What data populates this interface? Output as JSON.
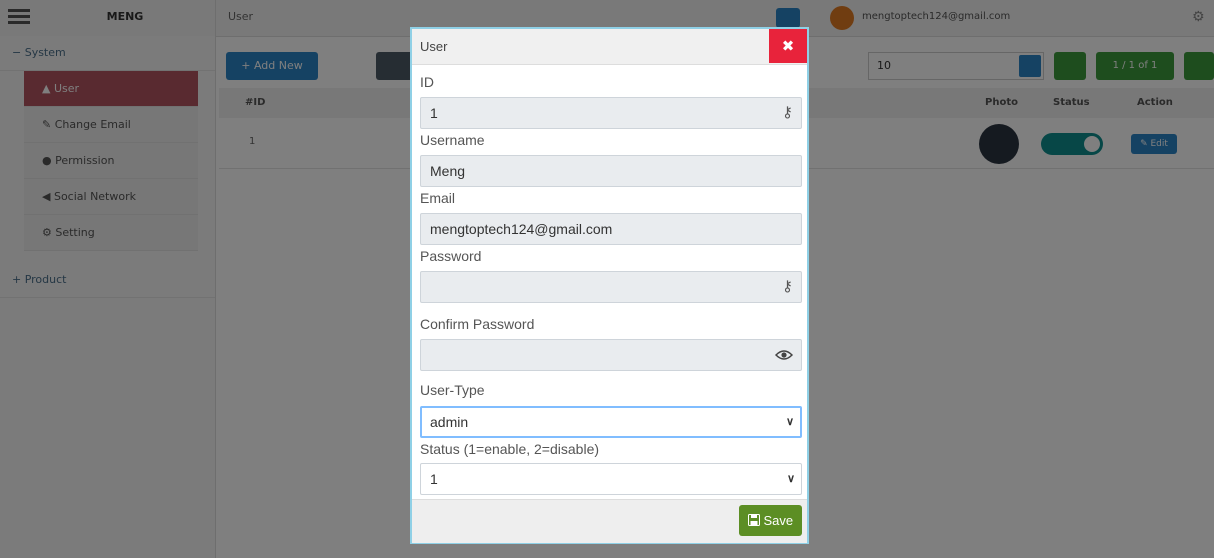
{
  "app": {
    "brand": "MENG",
    "breadcrumb": "User",
    "user_email": "mengtoptech124@gmail.com"
  },
  "sidebar": {
    "groups": [
      {
        "label": "− System"
      },
      {
        "label": "+ Product"
      }
    ],
    "items": [
      {
        "label": "▲ User"
      },
      {
        "label": "✎ Change Email"
      },
      {
        "label": "● Permission"
      },
      {
        "label": "◀ Social Network"
      },
      {
        "label": "⚙ Setting"
      }
    ]
  },
  "toolbar": {
    "add_new_label": "+ Add New",
    "page_size_value": "10",
    "pager_label": "1 / 1 of 1"
  },
  "table": {
    "columns": [
      "#ID",
      "Photo",
      "Status",
      "Action"
    ],
    "rows": [
      {
        "id": "1",
        "edit_label": "✎ Edit"
      }
    ]
  },
  "modal": {
    "title": "User",
    "close_label": "✖",
    "fields": {
      "id_label": "ID",
      "id_value": "1",
      "username_label": "Username",
      "username_value": "Meng",
      "email_label": "Email",
      "email_value": "mengtoptech124@gmail.com",
      "password_label": "Password",
      "password_value": "",
      "confirm_password_label": "Confirm Password",
      "confirm_password_value": "",
      "user_type_label": "User-Type",
      "user_type_value": "admin",
      "status_label": "Status (1=enable, 2=disable)",
      "status_value": "1"
    },
    "save_label": "Save"
  },
  "icons": {
    "key": "key-icon",
    "key_password": "key-icon",
    "eye": "eye-icon",
    "chevron": "chevron-down-icon",
    "save": "floppy-disk-icon",
    "close": "close-icon"
  },
  "colors": {
    "primary": "#2b84c6",
    "danger": "#e8233b",
    "success": "#5c8e24",
    "sidebar_active": "#b25560",
    "modal_border": "#8fd0e6"
  }
}
